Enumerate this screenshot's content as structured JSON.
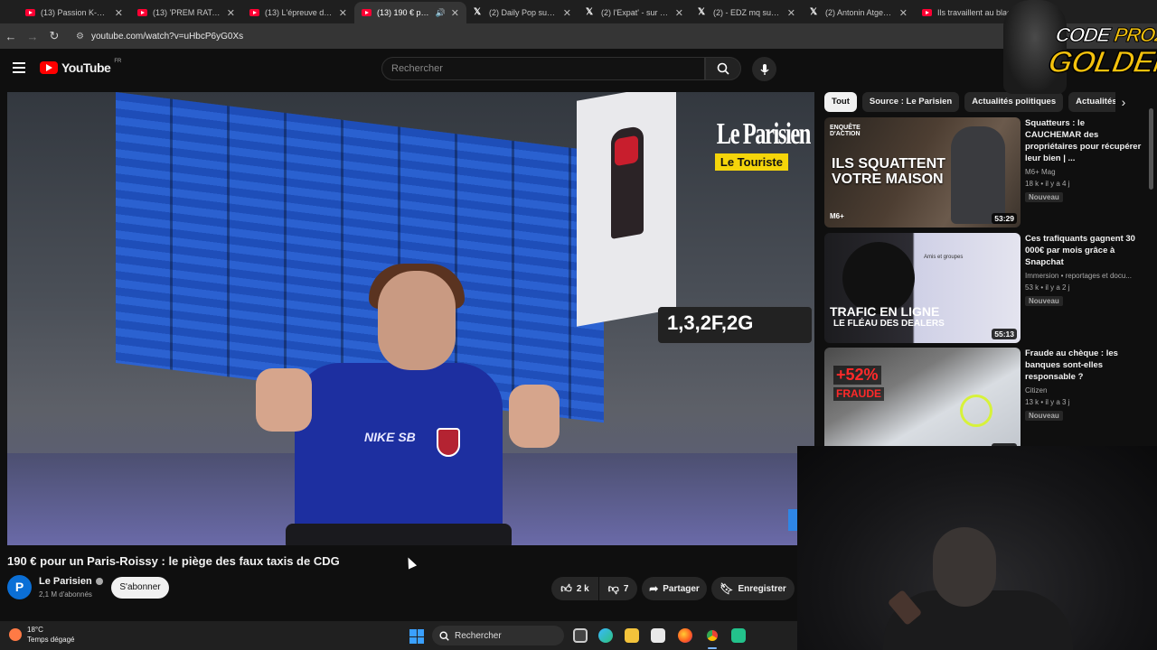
{
  "browser": {
    "tabs": [
      {
        "title": "(13) Passion K-pop |",
        "icon": "youtube-icon",
        "active": false
      },
      {
        "title": "(13) 'PREM RATAN D",
        "icon": "youtube-icon",
        "active": false
      },
      {
        "title": "(13) L'épreuve du 10(",
        "icon": "youtube-icon",
        "active": false
      },
      {
        "title": "(13) 190 € pour u",
        "icon": "youtube-icon",
        "active": true
      },
      {
        "title": "(2) Daily Pop sur X :",
        "icon": "x-icon",
        "active": false
      },
      {
        "title": "(2) l'Expat' - sur X : \"I",
        "icon": "x-icon",
        "active": false
      },
      {
        "title": "(2) - EDZ mq sur X :",
        "icon": "x-icon",
        "active": false
      },
      {
        "title": "(2) Antonin Atger sur",
        "icon": "x-icon",
        "active": false
      },
      {
        "title": "Ils travaillent au blac",
        "icon": "youtube-icon",
        "active": false
      }
    ],
    "url": "youtube.com/watch?v=uHbcP6yG0Xs"
  },
  "youtube": {
    "logo_text": "YouTube",
    "region": "FR",
    "search_placeholder": "Rechercher"
  },
  "video": {
    "overlay_brand": "Le Parisien",
    "overlay_tag": "Le Touriste",
    "gate_sign": "1,3,2F,2G",
    "shirt_logo": "NIKE SB",
    "title": "190 € pour un Paris-Roissy : le piège des faux taxis de CDG"
  },
  "channel": {
    "avatar_letter": "P",
    "name": "Le Parisien",
    "subscribers": "2,1 M d'abonnés",
    "subscribe_label": "S'abonner"
  },
  "actions": {
    "likes": "2 k",
    "dislikes": "7",
    "share_label": "Partager",
    "save_label": "Enregistrer"
  },
  "chips": [
    {
      "label": "Tout",
      "active": true
    },
    {
      "label": "Source : Le Parisien",
      "active": false
    },
    {
      "label": "Actualités politiques",
      "active": false
    },
    {
      "label": "Actualités in",
      "active": false
    }
  ],
  "recommendations": [
    {
      "title": "Squatteurs : le CAUCHEMAR des propriétaires pour récupérer leur bien | ...",
      "channel": "M6+ Mag",
      "views": "18 k",
      "age": "il y a 4 j",
      "badge": "Nouveau",
      "duration": "53:29",
      "thumb_kicker": "ENQUÊTE D'ACTION",
      "thumb_text": "ILS SQUATTENT VOTRE MAISON",
      "thumb_corner": "M6+"
    },
    {
      "title": "Ces trafiquants gagnent 30 000€ par mois grâce à Snapchat",
      "channel": "Immersion • reportages et docu...",
      "views": "53 k",
      "age": "il y a 2 j",
      "badge": "Nouveau",
      "duration": "55:13",
      "thumb_text": "TRAFIC EN LIGNE",
      "thumb_sub": "LE FLÉAU DES DEALERS",
      "thumb_ui": "Amis et groupes"
    },
    {
      "title": "Fraude au chèque : les banques sont-elles responsable ?",
      "channel": "Citizen",
      "views": "13 k",
      "age": "il y a 3 j",
      "badge": "Nouveau",
      "duration": "31:51",
      "thumb_text": "+52%",
      "thumb_sub": "FRAUDE"
    }
  ],
  "overlay_logo": {
    "line1_white": "CODE",
    "line1_yellow": "PROZIS",
    "line2": "GOLDENG"
  },
  "taskbar": {
    "temperature": "18°C",
    "weather_text": "Temps dégagé",
    "search_label": "Rechercher"
  },
  "colors": {
    "youtube_red": "#ff0000",
    "overlay_yellow": "#f5d50a",
    "background": "#0f0f0f"
  }
}
